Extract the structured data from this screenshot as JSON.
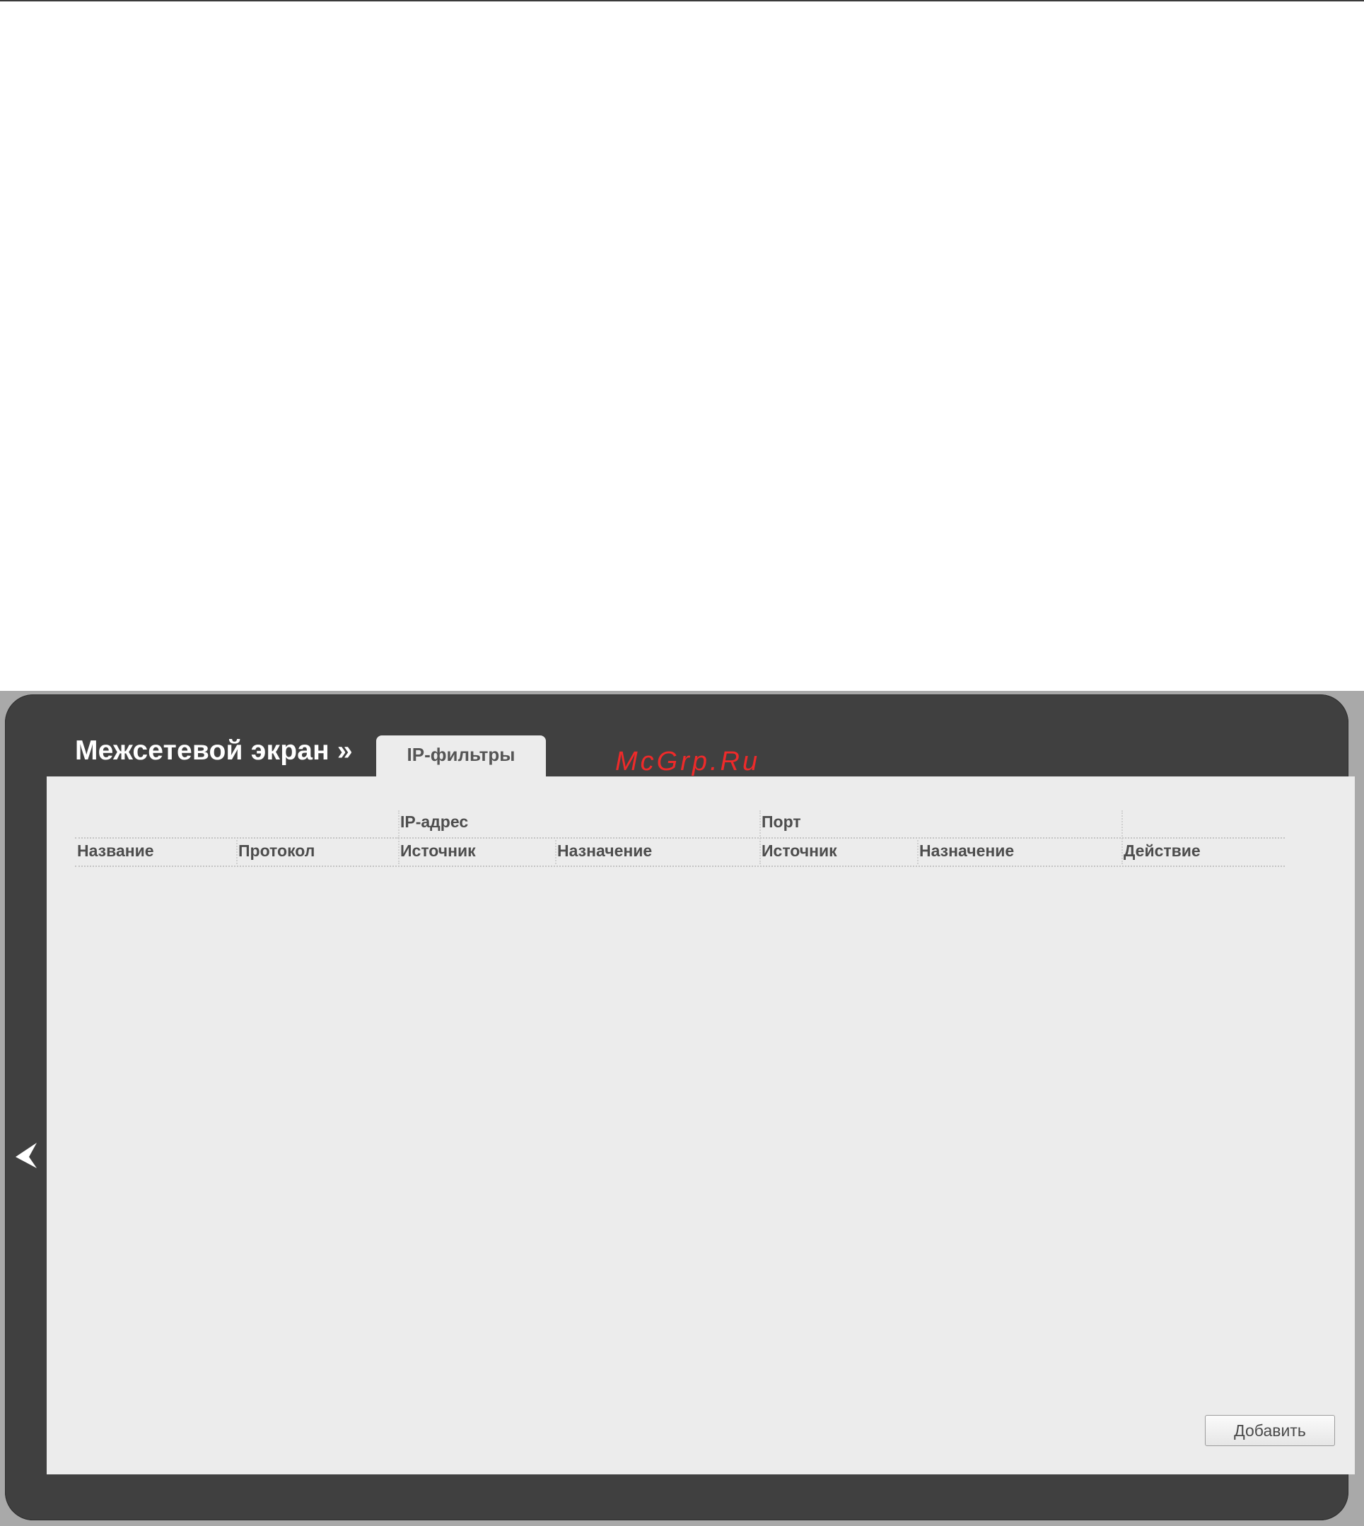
{
  "header": {
    "breadcrumb": "Межсетевой экран »",
    "active_tab": "IP-фильтры"
  },
  "watermark": "McGrp.Ru",
  "table": {
    "group_headers": {
      "ip_address": "IP-адрес",
      "port": "Порт"
    },
    "columns": [
      "Название",
      "Протокол",
      "Источник",
      "Назначение",
      "Источник",
      "Назначение",
      "Действие"
    ],
    "rows": []
  },
  "actions": {
    "add_label": "Добавить"
  },
  "icons": {
    "back": "chevron-left-icon"
  },
  "colors": {
    "frame": "#404040",
    "content": "#ececec",
    "title_text": "#ffffff",
    "watermark": "#ee2a2a"
  }
}
